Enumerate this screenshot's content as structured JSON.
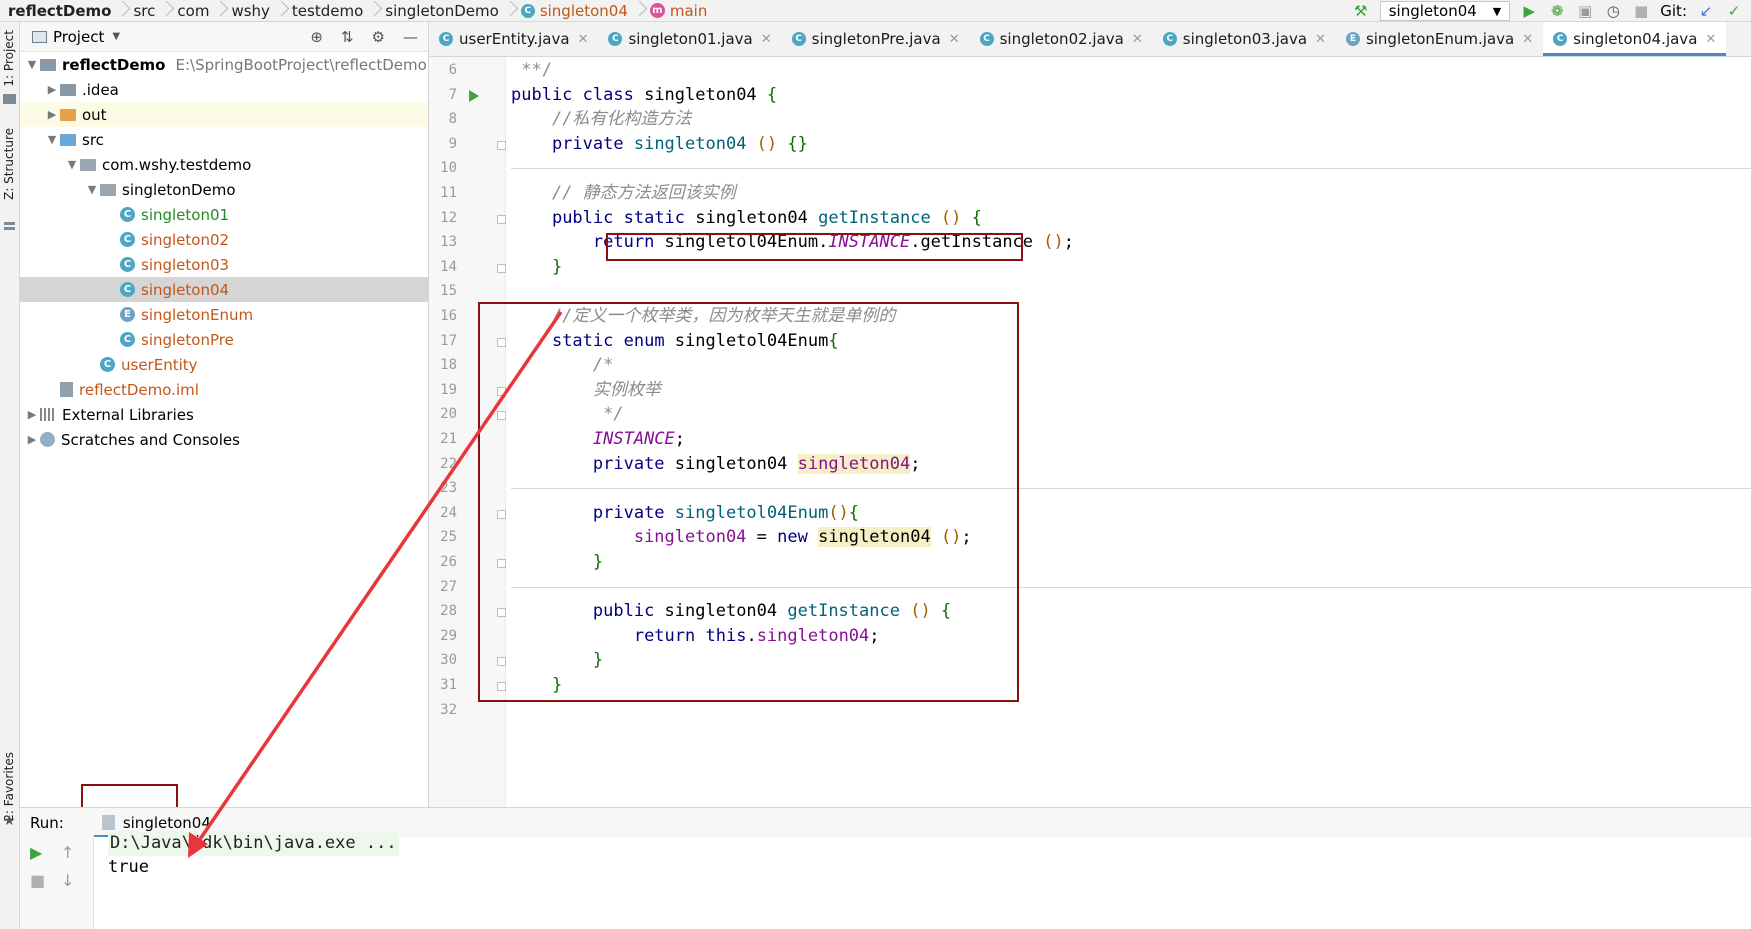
{
  "breadcrumb": [
    {
      "label": "reflectDemo",
      "style": "bold"
    },
    {
      "label": "src"
    },
    {
      "label": "com"
    },
    {
      "label": "wshy"
    },
    {
      "label": "testdemo"
    },
    {
      "label": "singletonDemo"
    },
    {
      "label": "singleton04",
      "style": "orange",
      "icon": "class-icon"
    },
    {
      "label": "main",
      "style": "orange",
      "icon": "method-icon"
    }
  ],
  "toolbar": {
    "run_config": "singleton04",
    "git_label": "Git:"
  },
  "left_strip": {
    "project_tab": "1: Project",
    "structure_tab": "Z: Structure",
    "favorites_tab": "2: Favorites"
  },
  "project_panel": {
    "title": "Project",
    "tree": [
      {
        "indent": 0,
        "arrow": "open",
        "icon": "folder",
        "label": "reflectDemo",
        "bold": true,
        "path": "E:\\SpringBootProject\\reflectDemo"
      },
      {
        "indent": 1,
        "arrow": "closed",
        "icon": "folder",
        "label": ".idea"
      },
      {
        "indent": 1,
        "arrow": "closed",
        "icon": "folder-orange",
        "label": "out",
        "highlight": true
      },
      {
        "indent": 1,
        "arrow": "open",
        "icon": "folder-blue",
        "label": "src"
      },
      {
        "indent": 2,
        "arrow": "open",
        "icon": "package",
        "label": "com.wshy.testdemo"
      },
      {
        "indent": 3,
        "arrow": "open",
        "icon": "package",
        "label": "singletonDemo"
      },
      {
        "indent": 4,
        "arrow": "none",
        "icon": "class",
        "label": "singleton01",
        "color": "green"
      },
      {
        "indent": 4,
        "arrow": "none",
        "icon": "class",
        "label": "singleton02",
        "color": "orange"
      },
      {
        "indent": 4,
        "arrow": "none",
        "icon": "class",
        "label": "singleton03",
        "color": "orange"
      },
      {
        "indent": 4,
        "arrow": "none",
        "icon": "class",
        "label": "singleton04",
        "color": "orange",
        "selected": true
      },
      {
        "indent": 4,
        "arrow": "none",
        "icon": "enum",
        "label": "singletonEnum",
        "color": "orange"
      },
      {
        "indent": 4,
        "arrow": "none",
        "icon": "class",
        "label": "singletonPre",
        "color": "orange"
      },
      {
        "indent": 3,
        "arrow": "none",
        "icon": "class",
        "label": "userEntity",
        "color": "orange"
      },
      {
        "indent": 1,
        "arrow": "none",
        "icon": "iml",
        "label": "reflectDemo.iml",
        "color": "orange"
      },
      {
        "indent": 0,
        "arrow": "closed",
        "icon": "library",
        "label": "External Libraries"
      },
      {
        "indent": 0,
        "arrow": "closed",
        "icon": "scratch",
        "label": "Scratches and Consoles"
      }
    ]
  },
  "editor_tabs": [
    {
      "label": "userEntity.java",
      "icon": "class"
    },
    {
      "label": "singleton01.java",
      "icon": "class"
    },
    {
      "label": "singletonPre.java",
      "icon": "class"
    },
    {
      "label": "singleton02.java",
      "icon": "class"
    },
    {
      "label": "singleton03.java",
      "icon": "class"
    },
    {
      "label": "singletonEnum.java",
      "icon": "enum"
    },
    {
      "label": "singleton04.java",
      "icon": "class",
      "active": true
    }
  ],
  "code": {
    "line_numbers": [
      "6",
      "7",
      "8",
      "9",
      "10",
      "11",
      "12",
      "13",
      "14",
      "15",
      "16",
      "17",
      "18",
      "19",
      "20",
      "21",
      "22",
      "23",
      "24",
      "25",
      "26",
      "27",
      "28",
      "29",
      "30",
      "31",
      "32"
    ],
    "lines": [
      [
        {
          "t": " **/",
          "c": "cm-plain"
        }
      ],
      [
        {
          "t": "public ",
          "c": "kw"
        },
        {
          "t": "class ",
          "c": "kw"
        },
        {
          "t": "singleton04 "
        },
        {
          "t": "{",
          "c": "brc"
        }
      ],
      [
        {
          "t": "    "
        },
        {
          "t": "//私有化构造方法",
          "c": "cm"
        }
      ],
      [
        {
          "t": "    "
        },
        {
          "t": "private ",
          "c": "kw"
        },
        {
          "t": "singleton04 ",
          "c": "mt"
        },
        {
          "t": "() ",
          "c": "par"
        },
        {
          "t": "{}",
          "c": "brc"
        }
      ],
      [],
      [
        {
          "t": "    "
        },
        {
          "t": "// 静态方法返回该实例",
          "c": "cm"
        }
      ],
      [
        {
          "t": "    "
        },
        {
          "t": "public ",
          "c": "kw"
        },
        {
          "t": "static ",
          "c": "kw"
        },
        {
          "t": "singleton04 "
        },
        {
          "t": "getInstance ",
          "c": "mt"
        },
        {
          "t": "() ",
          "c": "par"
        },
        {
          "t": "{",
          "c": "brc"
        }
      ],
      [
        {
          "t": "        "
        },
        {
          "t": "return ",
          "c": "kw"
        },
        {
          "t": "singletol04Enum."
        },
        {
          "t": "INSTANCE",
          "c": "en"
        },
        {
          "t": ".getInstance "
        },
        {
          "t": "()",
          "c": "par"
        },
        {
          "t": ";"
        }
      ],
      [
        {
          "t": "    "
        },
        {
          "t": "}",
          "c": "brc"
        }
      ],
      [],
      [
        {
          "t": "    "
        },
        {
          "t": "//定义一个枚举类，因为枚举天生就是单例的",
          "c": "cm"
        }
      ],
      [
        {
          "t": "    "
        },
        {
          "t": "static ",
          "c": "kw"
        },
        {
          "t": "enum ",
          "c": "kw"
        },
        {
          "t": "singletol04Enum"
        },
        {
          "t": "{",
          "c": "brc"
        }
      ],
      [
        {
          "t": "        "
        },
        {
          "t": "/*",
          "c": "cm"
        }
      ],
      [
        {
          "t": "        "
        },
        {
          "t": "实例枚举",
          "c": "cm"
        }
      ],
      [
        {
          "t": "         "
        },
        {
          "t": "*/",
          "c": "cm"
        }
      ],
      [
        {
          "t": "        "
        },
        {
          "t": "INSTANCE",
          "c": "en"
        },
        {
          "t": ";"
        }
      ],
      [
        {
          "t": "        "
        },
        {
          "t": "private ",
          "c": "kw"
        },
        {
          "t": "singleton04 "
        },
        {
          "t": "singleton04",
          "c": "fd hlbox"
        },
        {
          "t": ";"
        }
      ],
      [],
      [
        {
          "t": "        "
        },
        {
          "t": "private ",
          "c": "kw"
        },
        {
          "t": "singletol04Enum",
          "c": "mt"
        },
        {
          "t": "()",
          "c": "par"
        },
        {
          "t": "{",
          "c": "brc"
        }
      ],
      [
        {
          "t": "            "
        },
        {
          "t": "singleton04",
          "c": "fd"
        },
        {
          "t": " = "
        },
        {
          "t": "new ",
          "c": "kw"
        },
        {
          "t": "singleton04",
          "c": "hlbox"
        },
        {
          "t": " "
        },
        {
          "t": "()",
          "c": "par"
        },
        {
          "t": ";"
        }
      ],
      [
        {
          "t": "        "
        },
        {
          "t": "}",
          "c": "brc"
        }
      ],
      [],
      [
        {
          "t": "        "
        },
        {
          "t": "public ",
          "c": "kw"
        },
        {
          "t": "singleton04 "
        },
        {
          "t": "getInstance ",
          "c": "mt"
        },
        {
          "t": "() ",
          "c": "par"
        },
        {
          "t": "{",
          "c": "brc"
        }
      ],
      [
        {
          "t": "            "
        },
        {
          "t": "return ",
          "c": "kw"
        },
        {
          "t": "this",
          "c": "kw"
        },
        {
          "t": "."
        },
        {
          "t": "singleton04",
          "c": "fd"
        },
        {
          "t": ";"
        }
      ],
      [
        {
          "t": "        "
        },
        {
          "t": "}",
          "c": "brc"
        }
      ],
      [
        {
          "t": "    "
        },
        {
          "t": "}",
          "c": "brc"
        }
      ],
      []
    ]
  },
  "run_panel": {
    "label": "Run:",
    "tab": "singleton04",
    "output": [
      {
        "text": "D:\\Java\\jdk\\bin\\java.exe ...",
        "kind": "cmd"
      },
      {
        "text": "true",
        "kind": "result"
      }
    ]
  },
  "colors": {
    "annotation": "#8b1010",
    "arrow": "#e8363a",
    "tab_accent": "#4a88c7"
  }
}
